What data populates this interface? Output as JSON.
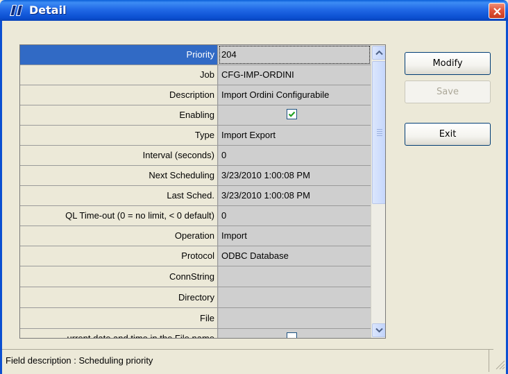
{
  "window": {
    "title": "Detail"
  },
  "grid": {
    "rows": [
      {
        "label": "Priority",
        "value": "204"
      },
      {
        "label": "Job",
        "value": "CFG-IMP-ORDINI"
      },
      {
        "label": "Description",
        "value": "Import Ordini Configurabile"
      },
      {
        "label": "Enabling",
        "value": "",
        "checked": true
      },
      {
        "label": "Type",
        "value": "Import Export"
      },
      {
        "label": "Interval (seconds)",
        "value": "0"
      },
      {
        "label": "Next Scheduling",
        "value": "3/23/2010 1:00:08 PM"
      },
      {
        "label": "Last Sched.",
        "value": "3/23/2010 1:00:08 PM"
      },
      {
        "label": "QL Time-out (0 = no limit, < 0 default)",
        "value": "0"
      },
      {
        "label": "Operation",
        "value": "Import"
      },
      {
        "label": "Protocol",
        "value": "ODBC Database"
      },
      {
        "label": "ConnString",
        "value": ""
      },
      {
        "label": "Directory",
        "value": ""
      },
      {
        "label": "File",
        "value": ""
      },
      {
        "label": "urrent date and time in the File name",
        "value": "",
        "checked": false
      }
    ]
  },
  "buttons": {
    "modify": "Modify",
    "save": "Save",
    "exit": "Exit"
  },
  "status": {
    "text": "Field description : Scheduling priority"
  }
}
